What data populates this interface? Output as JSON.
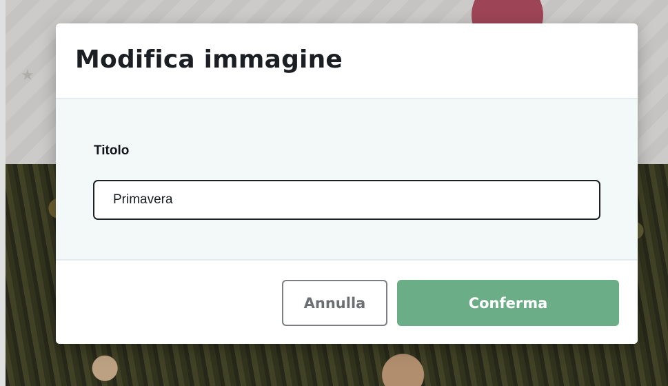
{
  "modal": {
    "title": "Modifica immagine",
    "field": {
      "label": "Titolo",
      "value": "Primavera"
    },
    "buttons": {
      "cancel_label": "Annulla",
      "confirm_label": "Conferma"
    }
  },
  "colors": {
    "confirm_button": "#6aad86",
    "modal_body_background": "#f3f8f9",
    "background_badge": "#b34f63"
  }
}
